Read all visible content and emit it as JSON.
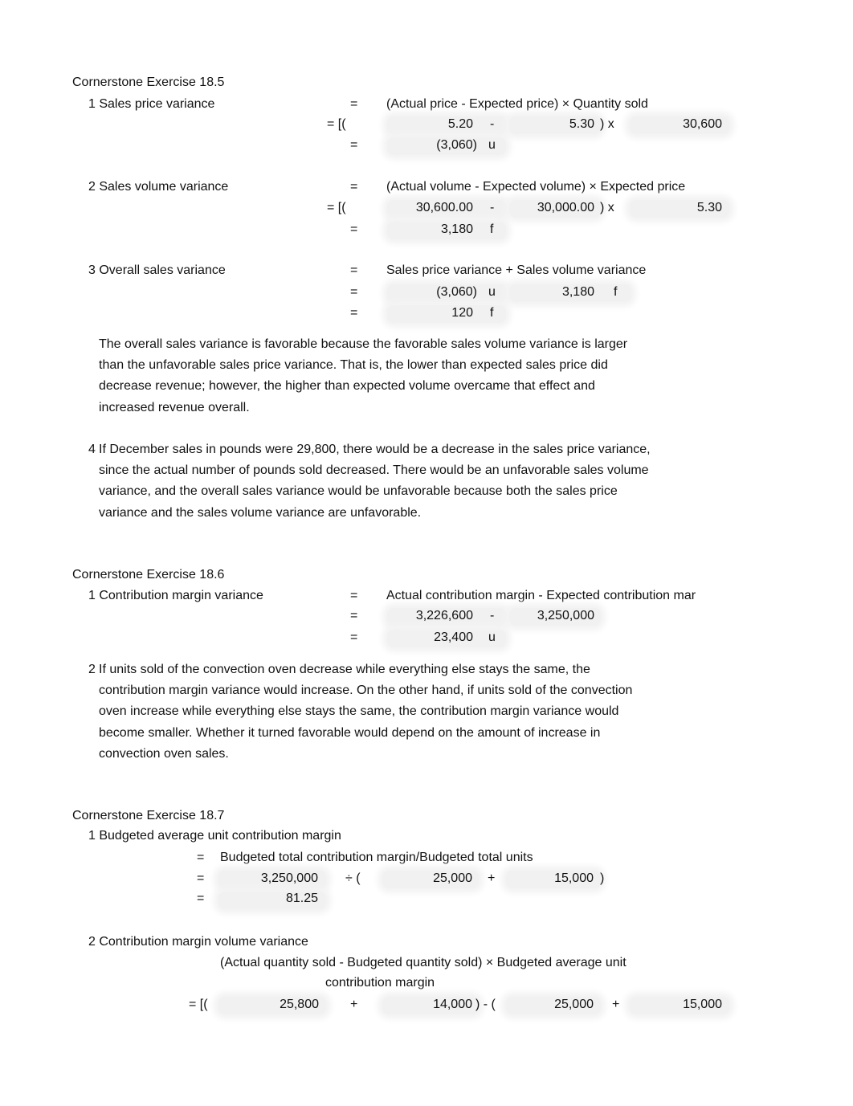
{
  "ex185": {
    "title": "Cornerstone Exercise 18.5",
    "q1": {
      "label": "1 Sales price variance",
      "eq": "=",
      "formula": "(Actual price - Expected price) × Quantity sold",
      "row2_prefix": "=  [(",
      "actual_price": "5.20",
      "minus": "-",
      "expected_price": "5.30",
      "close_times": ")  x",
      "quantity_sold": "30,600",
      "result": "(3,060)",
      "result_flag": "u"
    },
    "q2": {
      "label": "2 Sales volume variance",
      "eq": "=",
      "formula": "(Actual volume - Expected volume) × Expected price",
      "row2_prefix": "=  [(",
      "actual_volume": "30,600.00",
      "minus": "-",
      "expected_volume": "30,000.00",
      "close_times": ")  x",
      "expected_price": "5.30",
      "result": "3,180",
      "result_flag": "f"
    },
    "q3": {
      "label": "3 Overall sales variance",
      "eq": "=",
      "formula": "Sales price variance + Sales volume variance",
      "price_var": "(3,060)",
      "price_flag": "u",
      "volume_var": "3,180",
      "volume_flag": "f",
      "result": "120",
      "result_flag": "f"
    },
    "explanation": [
      "The overall sales variance is favorable because the favorable sales volume variance is larger",
      "than the unfavorable sales price variance. That is, the lower than expected sales price did",
      "decrease revenue; however, the higher than expected volume overcame that effect and",
      "increased revenue overall."
    ],
    "q4": {
      "number": "4",
      "lines": [
        "If December sales in pounds were 29,800, there would be a decrease in the sales price variance,",
        "since the actual number of pounds sold decreased. There would be an unfavorable sales volume",
        "variance, and the overall sales variance would be unfavorable because both the sales price",
        "variance and the sales volume variance are unfavorable."
      ]
    }
  },
  "ex186": {
    "title": "Cornerstone Exercise 18.6",
    "q1": {
      "label": "1 Contribution margin variance",
      "eq": "=",
      "formula": "Actual contribution margin - Expected contribution mar",
      "actual_cm": "3,226,600",
      "minus": "-",
      "expected_cm": "3,250,000",
      "result": "23,400",
      "result_flag": "u"
    },
    "q2": {
      "number": "2",
      "lines": [
        "If units sold of the convection oven decrease while everything else stays the same, the",
        "contribution margin variance would increase. On the other hand, if units sold of the convection",
        "oven increase while everything else stays the same, the contribution margin variance would",
        "become smaller. Whether it turned favorable would depend on the amount of increase in",
        "convection oven sales."
      ]
    }
  },
  "ex187": {
    "title": "Cornerstone Exercise 18.7",
    "q1": {
      "label": "1 Budgeted average unit contribution margin",
      "eq": "=",
      "formula": "Budgeted total contribution margin/Budgeted total units",
      "total_cm": "3,250,000",
      "divide_open": "÷  (",
      "units_a": "25,000",
      "plus": "+",
      "units_b": "15,000",
      "close": ")",
      "result": "81.25"
    },
    "q2": {
      "label": "2 Contribution margin volume variance",
      "formula_line1": "(Actual quantity sold - Budgeted quantity sold) × Budgeted average unit",
      "formula_line2": "contribution margin",
      "row_prefix": "=  [(",
      "actual_a": "25,800",
      "plus1": "+",
      "actual_b": "14,000",
      "mid": ") - (",
      "budget_a": "25,000",
      "plus2": "+",
      "budget_b": "15,000"
    }
  }
}
